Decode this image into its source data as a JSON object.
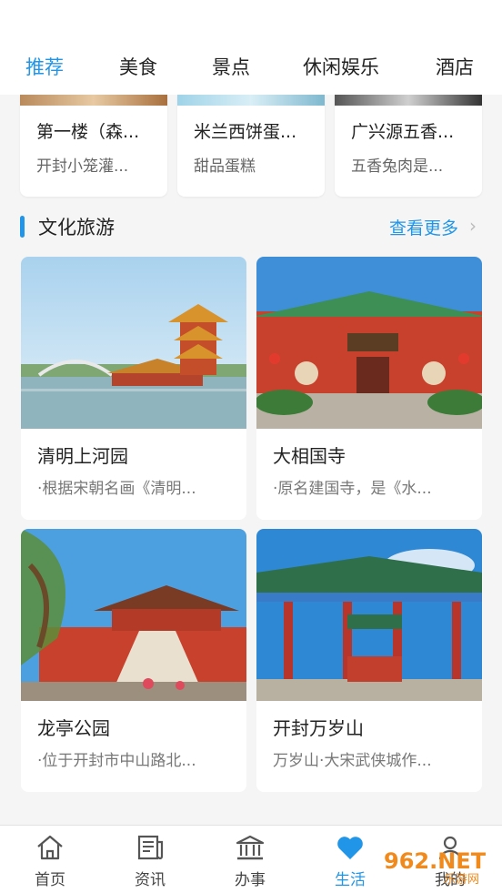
{
  "tabs": [
    {
      "label": "推荐",
      "active": true
    },
    {
      "label": "美食",
      "active": false
    },
    {
      "label": "景点",
      "active": false
    },
    {
      "label": "休闲娱乐",
      "active": false
    },
    {
      "label": "酒店",
      "active": false
    }
  ],
  "food_cards": [
    {
      "title": "第一楼（森...",
      "subtitle": "开封小笼灌..."
    },
    {
      "title": "米兰西饼蛋...",
      "subtitle": "甜品蛋糕"
    },
    {
      "title": "广兴源五香...",
      "subtitle": "五香兔肉是..."
    }
  ],
  "section": {
    "title": "文化旅游",
    "more": "查看更多"
  },
  "attractions": [
    {
      "title": "清明上河园",
      "desc": "·根据宋朝名画《清明..."
    },
    {
      "title": "大相国寺",
      "desc": "·原名建国寺，是《水..."
    },
    {
      "title": "龙亭公园",
      "desc": "·位于开封市中山路北..."
    },
    {
      "title": "开封万岁山",
      "desc": "万岁山·大宋武侠城作..."
    }
  ],
  "bottom_nav": [
    {
      "label": "首页",
      "icon": "home-icon"
    },
    {
      "label": "资讯",
      "icon": "news-icon"
    },
    {
      "label": "办事",
      "icon": "government-building-icon"
    },
    {
      "label": "生活",
      "icon": "heart-icon",
      "active": true
    },
    {
      "label": "我的",
      "icon": "user-icon"
    }
  ],
  "watermark": {
    "brand": "962.NET",
    "sub": "乐游网"
  },
  "colors": {
    "accent": "#2196e8",
    "text": "#222222",
    "muted": "#777777",
    "background": "#f5f5f5"
  }
}
